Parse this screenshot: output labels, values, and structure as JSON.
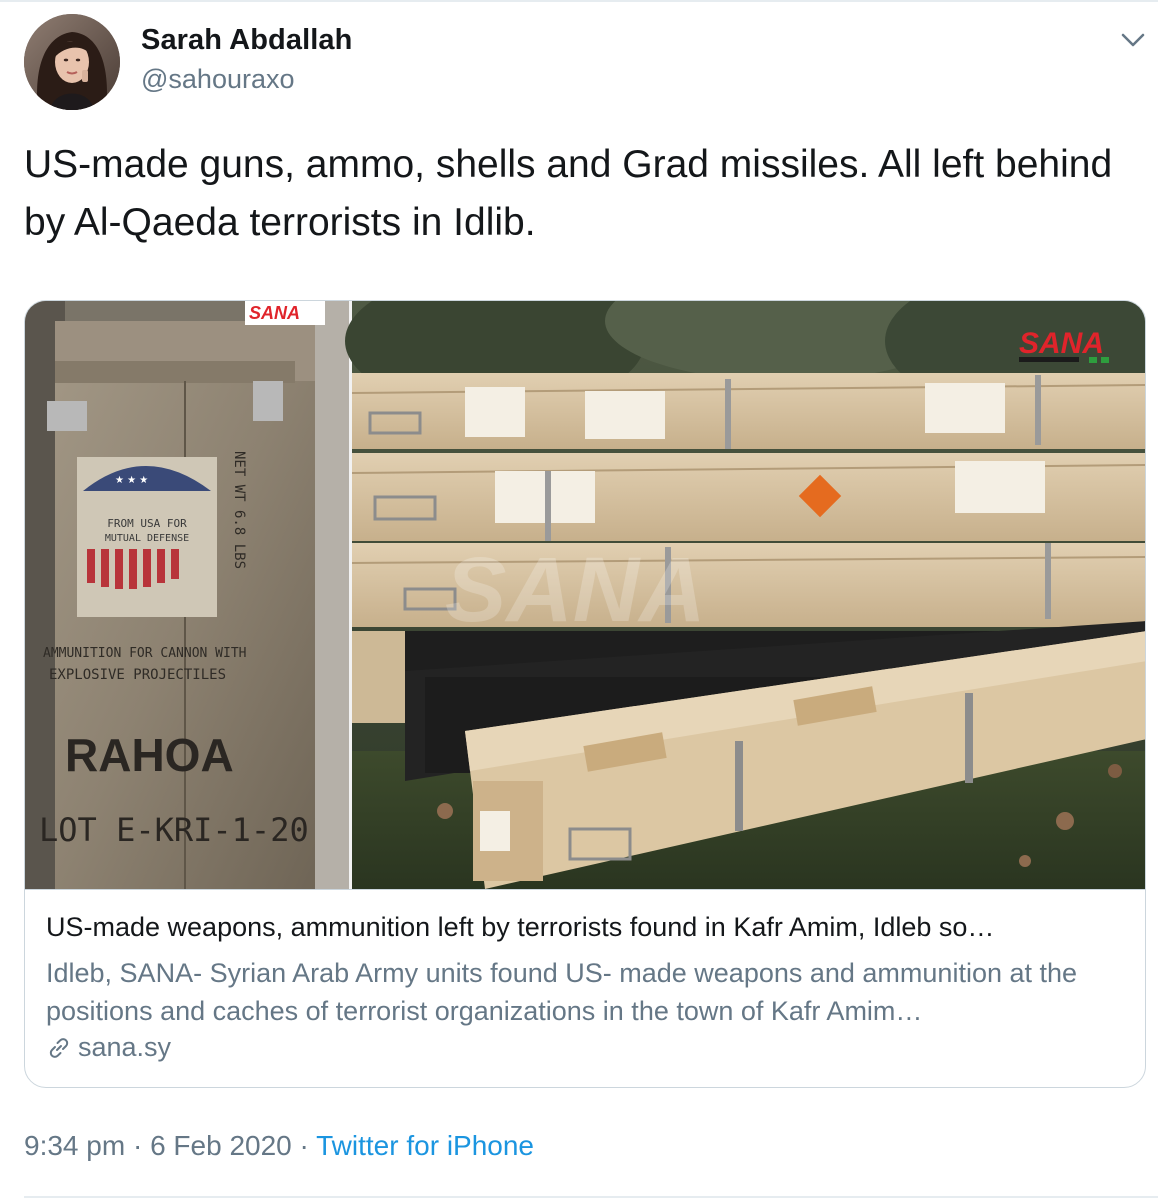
{
  "author": {
    "name": "Sarah Abdallah",
    "handle": "@sahouraxo"
  },
  "tweet": {
    "text": "US-made guns, ammo, shells and Grad missiles. All left behind by Al-Qaeda terrorists in Idlib."
  },
  "card": {
    "image_left": {
      "watermark": "SANA",
      "stencil_lines": [
        "FROM USA FOR",
        "MUTUAL DEFENSE",
        "AMMUNITION FOR CANNON WITH",
        "EXPLOSIVE PROJECTILES",
        "RAHOA",
        "LOT E-KRI-1-20"
      ]
    },
    "image_right": {
      "watermark": "SANA",
      "overlay_watermark": "SANA"
    },
    "title": "US-made weapons, ammunition left by terrorists found in Kafr Amim, Idleb so…",
    "description": "Idleb, SANA- Syrian Arab Army units found US- made weapons and ammunition at the positions and caches of terrorist organizations in the town of Kafr Amim…",
    "domain": "sana.sy"
  },
  "meta": {
    "time": "9:34 pm",
    "separator": "·",
    "date": "6 Feb 2020",
    "source": "Twitter for iPhone"
  },
  "icons": {
    "caret": "chevron-down-icon",
    "link": "link-icon"
  },
  "colors": {
    "text": "#14171a",
    "secondary": "#657786",
    "link": "#1b95e0",
    "border": "#ccd6dd",
    "sana_red": "#e0242b",
    "sana_green": "#2e9e3e"
  }
}
